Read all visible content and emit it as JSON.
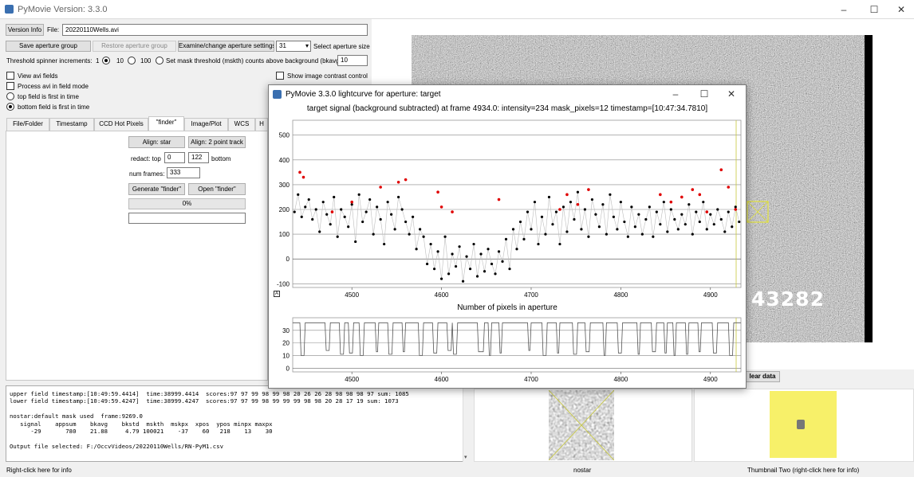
{
  "window": {
    "title": "PyMovie  Version: 3.3.0"
  },
  "toolbar": {
    "version_info": "Version Info",
    "file_label": "File:",
    "file_value": "20220110Wells.avi",
    "save_aperture_group": "Save aperture group",
    "restore_aperture_group": "Restore aperture group",
    "examine_aperture_settings": "Examine/change aperture settings",
    "aperture_size_value": "31",
    "select_aperture_size": "Select aperture size",
    "threshold_label": "Threshold spinner increments:",
    "inc_1": "1",
    "inc_10": "10",
    "inc_100": "100",
    "mask_threshold_label": "Set mask threshold (mskth) counts above background (bkavg)",
    "mask_threshold_value": "10",
    "view_avi_fields": "View avi fields",
    "show_contrast": "Show image contrast control",
    "process_field_mode": "Process avi in field mode",
    "top_field_first": "top field is first in time",
    "bottom_field_first": "bottom field is first in time"
  },
  "tabs": [
    "File/Folder",
    "Timestamp",
    "CCD Hot Pixels",
    "\"finder\"",
    "Image/Plot",
    "WCS",
    "H"
  ],
  "finder": {
    "align_star": "Align: star",
    "align_2pt": "Align: 2 point track",
    "redact_top_label": "redact: top",
    "redact_top_value": "0",
    "redact_bottom_value": "122",
    "redact_bottom_label": "bottom",
    "num_frames_label": "num frames:",
    "num_frames_value": "333",
    "generate": "Generate \"finder\"",
    "open": "Open \"finder\"",
    "progress_text": "0%",
    "progress_fraction": 0
  },
  "image": {
    "overlay_number": "43282"
  },
  "log_lines": [
    "upper field timestamp:[10:49:59.4414]  time:38999.4414  scores:97 97 99 98 99 98 20 26 26 28 98 98 98 97 sum: 1085",
    "lower field timestamp:[10:49:59.4247]  time:38999.4247  scores:97 97 99 98 99 99 99 98 98 20 28 17 19 sum: 1073",
    "",
    "nostar:default mask used  frame:9269.0",
    "   signal    appsum    bkavg    bkstd  mskth  mskpx  xpos  ypos minpx maxpx",
    "      -29       780    21.88     4.79 100021    -37    60   218    13    30",
    "",
    "Output file selected: F:/OccvVideos/20220110Wells/RN-PyM1.csv"
  ],
  "clear_data_label": "lear data",
  "lightcurve_window": {
    "title": "PyMovie 3.3.0 lightcurve for aperture: target",
    "main_title": "target signal (background subtracted) at frame 4934.0: intensity=234 mask_pixels=12 timestamp=[10:47:34.7810]",
    "sub_title": "Number of pixels in aperture",
    "autoscale_label": "A"
  },
  "chart_data": [
    {
      "type": "scatter",
      "title": "target signal (background subtracted) at frame 4934.0: intensity=234 mask_pixels=12 timestamp=[10:47:34.7810]",
      "xlim": [
        4434,
        4934
      ],
      "ylim": [
        -115,
        560
      ],
      "xticks": [
        4500,
        4600,
        4700,
        4800,
        4900
      ],
      "yticks": [
        -100,
        0,
        100,
        200,
        300,
        400,
        500
      ],
      "grid": true,
      "series": [
        {
          "color": "#000000",
          "values_description_free": true,
          "x": [
            4436,
            4440,
            4444,
            4448,
            4452,
            4456,
            4460,
            4464,
            4468,
            4472,
            4476,
            4480,
            4484,
            4488,
            4492,
            4496,
            4500,
            4504,
            4508,
            4512,
            4516,
            4520,
            4524,
            4528,
            4532,
            4536,
            4540,
            4544,
            4548,
            4552,
            4556,
            4560,
            4564,
            4568,
            4572,
            4576,
            4580,
            4584,
            4588,
            4592,
            4596,
            4600,
            4604,
            4608,
            4612,
            4616,
            4620,
            4624,
            4628,
            4632,
            4636,
            4640,
            4644,
            4648,
            4652,
            4656,
            4660,
            4664,
            4668,
            4672,
            4676,
            4680,
            4684,
            4688,
            4692,
            4696,
            4700,
            4704,
            4708,
            4712,
            4716,
            4720,
            4724,
            4728,
            4732,
            4736,
            4740,
            4744,
            4748,
            4752,
            4756,
            4760,
            4764,
            4768,
            4772,
            4776,
            4780,
            4784,
            4788,
            4792,
            4796,
            4800,
            4804,
            4808,
            4812,
            4816,
            4820,
            4824,
            4828,
            4832,
            4836,
            4840,
            4844,
            4848,
            4852,
            4856,
            4860,
            4864,
            4868,
            4872,
            4876,
            4880,
            4884,
            4888,
            4892,
            4896,
            4900,
            4904,
            4908,
            4912,
            4916,
            4920,
            4924,
            4928,
            4932
          ],
          "y": [
            190,
            260,
            170,
            210,
            240,
            160,
            200,
            110,
            230,
            180,
            140,
            250,
            90,
            200,
            170,
            130,
            220,
            70,
            260,
            150,
            190,
            240,
            100,
            210,
            160,
            60,
            230,
            180,
            120,
            250,
            200,
            150,
            100,
            170,
            40,
            120,
            90,
            -20,
            60,
            -40,
            30,
            -80,
            90,
            -60,
            20,
            -30,
            50,
            -90,
            10,
            -40,
            60,
            -70,
            20,
            -50,
            40,
            -20,
            -60,
            30,
            -10,
            80,
            -40,
            120,
            40,
            150,
            80,
            190,
            120,
            230,
            60,
            170,
            100,
            250,
            140,
            190,
            60,
            210,
            110,
            230,
            160,
            270,
            120,
            200,
            90,
            240,
            180,
            130,
            220,
            100,
            260,
            170,
            120,
            230,
            150,
            90,
            210,
            130,
            180,
            100,
            160,
            210,
            90,
            190,
            140,
            230,
            110,
            200,
            160,
            120,
            180,
            140,
            220,
            100,
            190,
            150,
            230,
            120,
            180,
            140,
            200,
            160,
            110,
            190,
            130,
            210,
            150
          ]
        },
        {
          "color": "#e00000",
          "x": [
            4442,
            4446,
            4478,
            4500,
            4532,
            4552,
            4560,
            4596,
            4600,
            4612,
            4664,
            4732,
            4740,
            4752,
            4764,
            4844,
            4856,
            4868,
            4880,
            4888,
            4896,
            4912,
            4920,
            4928
          ],
          "y": [
            350,
            330,
            190,
            230,
            290,
            310,
            320,
            270,
            210,
            190,
            240,
            200,
            260,
            220,
            280,
            260,
            230,
            250,
            280,
            260,
            190,
            360,
            290,
            200
          ]
        }
      ]
    },
    {
      "type": "line",
      "title": "Number of pixels in aperture",
      "xlim": [
        4434,
        4934
      ],
      "ylim": [
        -3,
        40
      ],
      "xticks": [
        4500,
        4600,
        4700,
        4800,
        4900
      ],
      "yticks": [
        0,
        10,
        20,
        30
      ],
      "grid": true,
      "series": [
        {
          "color": "#555555",
          "base": 36,
          "dips": [
            [
              4442,
              4448,
              10
            ],
            [
              4470,
              4476,
              14
            ],
            [
              4486,
              4492,
              11
            ],
            [
              4496,
              4502,
              12
            ],
            [
              4508,
              4514,
              10
            ],
            [
              4526,
              4530,
              13
            ],
            [
              4540,
              4546,
              11
            ],
            [
              4556,
              4560,
              13
            ],
            [
              4574,
              4580,
              10
            ],
            [
              4590,
              4596,
              12
            ],
            [
              4606,
              4612,
              14
            ],
            [
              4612,
              4618,
              11
            ],
            [
              4640,
              4648,
              13
            ],
            [
              4652,
              4656,
              10
            ],
            [
              4664,
              4668,
              12
            ],
            [
              4696,
              4700,
              14
            ],
            [
              4712,
              4718,
              10
            ],
            [
              4728,
              4732,
              12
            ],
            [
              4746,
              4752,
              11
            ],
            [
              4760,
              4766,
              13
            ],
            [
              4780,
              4784,
              10
            ],
            [
              4796,
              4802,
              12
            ],
            [
              4818,
              4822,
              11
            ],
            [
              4834,
              4840,
              13
            ],
            [
              4848,
              4852,
              12
            ],
            [
              4858,
              4862,
              10
            ],
            [
              4872,
              4876,
              11
            ],
            [
              4886,
              4890,
              13
            ],
            [
              4902,
              4908,
              12
            ],
            [
              4920,
              4926,
              10
            ]
          ]
        }
      ]
    }
  ],
  "thumbnails": {
    "one_label": "nostar",
    "two_label": "Thumbnail Two (right-click here for info)"
  },
  "status": {
    "left_hint": "Right-click here for info"
  },
  "colors": {
    "thumbnail_two_bg": "#f7f069",
    "overlay_yellow": "#e2e23a",
    "red_points": "#e00000"
  }
}
